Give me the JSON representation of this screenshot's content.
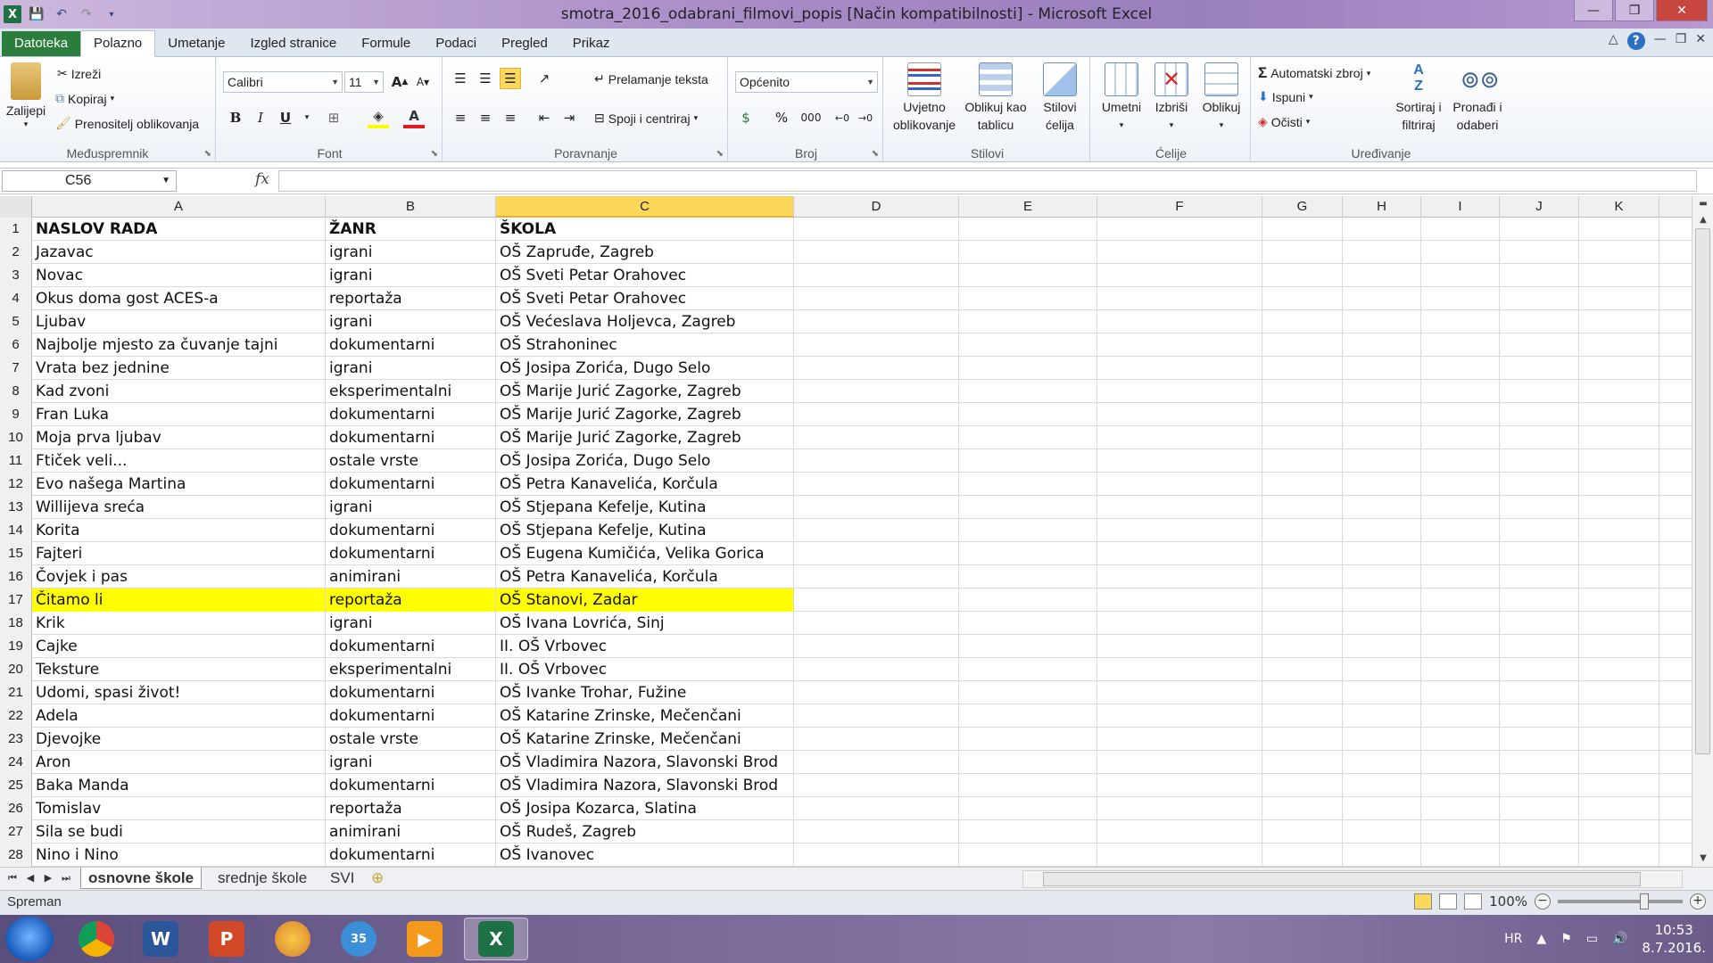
{
  "window": {
    "title": "smotra_2016_odabrani_filmovi_popis  [Način kompatibilnosti]  -  Microsoft Excel",
    "minimize": "—",
    "restore": "❐",
    "close": "✕"
  },
  "ribbon_tabs": [
    "Datoteka",
    "Polazno",
    "Umetanje",
    "Izgled stranice",
    "Formule",
    "Podaci",
    "Pregled",
    "Prikaz"
  ],
  "clipboard": {
    "paste": "Zalijepi",
    "cut": "Izreži",
    "copy": "Kopiraj",
    "format_painter": "Prenositelj oblikovanja",
    "label": "Međuspremnik"
  },
  "font": {
    "name": "Calibri",
    "size": "11",
    "bold": "B",
    "italic": "I",
    "underline": "U",
    "label": "Font"
  },
  "alignment": {
    "wrap_text": "Prelamanje teksta",
    "merge_center": "Spoji i centriraj",
    "label": "Poravnanje"
  },
  "number": {
    "format": "Općenito",
    "percent": "%",
    "thousands": "000",
    "label": "Broj"
  },
  "styles": {
    "conditional": [
      "Uvjetno",
      "oblikovanje"
    ],
    "as_table": [
      "Oblikuj kao",
      "tablicu"
    ],
    "cell_styles": [
      "Stilovi",
      "ćelija"
    ],
    "label": "Stilovi"
  },
  "cells": {
    "insert": "Umetni",
    "delete": "Izbriši",
    "format": "Oblikuj",
    "label": "Ćelije"
  },
  "editing": {
    "autosum": "Automatski zbroj",
    "fill": "Ispuni",
    "clear": "Očisti",
    "sort_filter": [
      "Sortiraj i",
      "filtriraj"
    ],
    "find_select": [
      "Pronađi i",
      "odaberi"
    ],
    "label": "Uređivanje"
  },
  "formula_bar": {
    "name_box": "C56",
    "fx": "fx",
    "value": ""
  },
  "columns": [
    "A",
    "B",
    "C",
    "D",
    "E",
    "F",
    "G",
    "H",
    "I",
    "J",
    "K"
  ],
  "rows": [
    {
      "n": "1",
      "a": "NASLOV RADA",
      "b": "ŽANR",
      "c": "ŠKOLA"
    },
    {
      "n": "2",
      "a": "Jazavac",
      "b": "igrani",
      "c": "OŠ Zapruđe, Zagreb"
    },
    {
      "n": "3",
      "a": "Novac",
      "b": "igrani",
      "c": "OŠ Sveti Petar Orahovec"
    },
    {
      "n": "4",
      "a": "Okus doma gost ACES-a",
      "b": "reportaža",
      "c": "OŠ Sveti Petar Orahovec"
    },
    {
      "n": "5",
      "a": "Ljubav",
      "b": "igrani",
      "c": "OŠ Većeslava Holjevca, Zagreb"
    },
    {
      "n": "6",
      "a": "Najbolje mjesto za čuvanje tajni",
      "b": "dokumentarni",
      "c": "OŠ Strahoninec"
    },
    {
      "n": "7",
      "a": "Vrata bez jednine",
      "b": "igrani",
      "c": "OŠ Josipa Zorića, Dugo Selo"
    },
    {
      "n": "8",
      "a": "Kad zvoni",
      "b": "eksperimentalni",
      "c": "OŠ Marije Jurić Zagorke, Zagreb"
    },
    {
      "n": "9",
      "a": "Fran Luka",
      "b": "dokumentarni",
      "c": "OŠ Marije Jurić Zagorke, Zagreb"
    },
    {
      "n": "10",
      "a": "Moja prva ljubav",
      "b": "dokumentarni",
      "c": "OŠ Marije Jurić Zagorke, Zagreb"
    },
    {
      "n": "11",
      "a": "Ftiček veli...",
      "b": "ostale vrste",
      "c": "OŠ Josipa Zorića, Dugo Selo"
    },
    {
      "n": "12",
      "a": "Evo našega Martina",
      "b": "dokumentarni",
      "c": "OŠ Petra Kanavelića, Korčula"
    },
    {
      "n": "13",
      "a": "Willijeva sreća",
      "b": "igrani",
      "c": "OŠ Stjepana Kefelje, Kutina"
    },
    {
      "n": "14",
      "a": "Korita",
      "b": "dokumentarni",
      "c": "OŠ Stjepana Kefelje, Kutina"
    },
    {
      "n": "15",
      "a": "Fajteri",
      "b": "dokumentarni",
      "c": "OŠ Eugena Kumičića, Velika Gorica"
    },
    {
      "n": "16",
      "a": "Čovjek i pas",
      "b": "animirani",
      "c": "OŠ Petra Kanavelića, Korčula"
    },
    {
      "n": "17",
      "a": "Čitamo li",
      "b": "reportaža",
      "c": "OŠ Stanovi, Zadar"
    },
    {
      "n": "18",
      "a": "Krik",
      "b": "igrani",
      "c": "OŠ Ivana Lovrića, Sinj"
    },
    {
      "n": "19",
      "a": "Cajke",
      "b": "dokumentarni",
      "c": "II. OŠ Vrbovec"
    },
    {
      "n": "20",
      "a": "Teksture",
      "b": "eksperimentalni",
      "c": "II. OŠ Vrbovec"
    },
    {
      "n": "21",
      "a": "Udomi, spasi život!",
      "b": "dokumentarni",
      "c": "OŠ Ivanke Trohar, Fužine"
    },
    {
      "n": "22",
      "a": "Adela",
      "b": "dokumentarni",
      "c": "OŠ Katarine Zrinske, Mečenčani"
    },
    {
      "n": "23",
      "a": "Djevojke",
      "b": "ostale vrste",
      "c": "OŠ Katarine Zrinske, Mečenčani"
    },
    {
      "n": "24",
      "a": "Aron",
      "b": "igrani",
      "c": "OŠ Vladimira Nazora, Slavonski Brod"
    },
    {
      "n": "25",
      "a": "Baka Manda",
      "b": "dokumentarni",
      "c": "OŠ Vladimira Nazora, Slavonski Brod"
    },
    {
      "n": "26",
      "a": "Tomislav",
      "b": "reportaža",
      "c": "OŠ Josipa Kozarca, Slatina"
    },
    {
      "n": "27",
      "a": "Sila se budi",
      "b": "animirani",
      "c": "OŠ Rudeš, Zagreb"
    },
    {
      "n": "28",
      "a": "Nino i Nino",
      "b": "dokumentarni",
      "c": "OŠ Ivanovec"
    }
  ],
  "highlight_color": "#ffff00",
  "sheet_tabs": [
    "osnovne škole",
    "srednje škole",
    "SVI"
  ],
  "status": {
    "ready": "Spreman",
    "zoom": "100%"
  },
  "taskbar": {
    "apps": [
      "chrome-icon",
      "word-icon",
      "powerpoint-icon",
      "paint-icon",
      "app-icon",
      "media-player-icon",
      "excel-icon"
    ],
    "language": "HR",
    "time": "10:53",
    "date": "8.7.2016."
  }
}
